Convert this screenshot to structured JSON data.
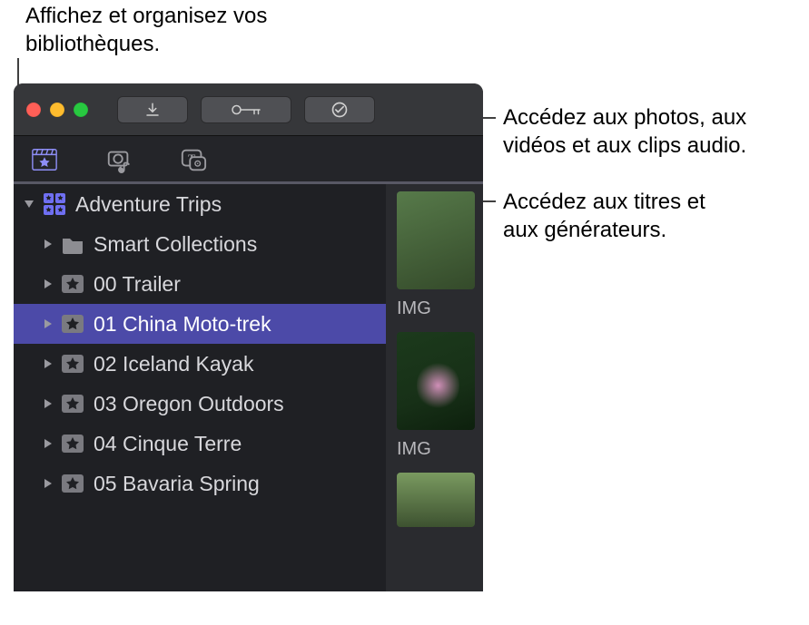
{
  "callouts": {
    "libraries": "Affichez et organisez vos\nbibliothèques.",
    "media": "Accédez aux photos, aux\nvidéos et aux clips audio.",
    "titles": "Accédez aux titres et\naux générateurs."
  },
  "toolbar": {
    "import_icon": "download-arrow",
    "keyword_icon": "key",
    "tasks_icon": "checkmark-circle"
  },
  "tabs": {
    "libraries_icon": "clapperboard-star",
    "media_icon": "camera-music",
    "titles_icon": "text-bubble"
  },
  "library": {
    "name": "Adventure Trips",
    "items": [
      {
        "icon": "folder",
        "label": "Smart Collections"
      },
      {
        "icon": "star-box",
        "label": "00 Trailer"
      },
      {
        "icon": "star-box",
        "label": "01 China Moto-trek",
        "selected": true
      },
      {
        "icon": "star-box",
        "label": "02 Iceland Kayak"
      },
      {
        "icon": "star-box",
        "label": "03 Oregon Outdoors"
      },
      {
        "icon": "star-box",
        "label": "04 Cinque Terre"
      },
      {
        "icon": "star-box",
        "label": "05 Bavaria Spring"
      }
    ]
  },
  "thumbs": {
    "label_prefix": "IMG"
  }
}
